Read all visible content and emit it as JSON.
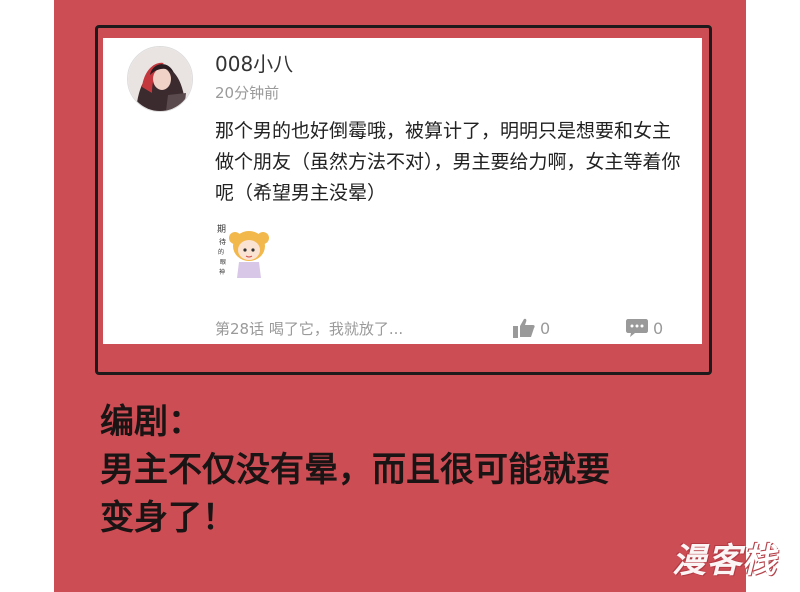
{
  "comment_card": {
    "username": "008小八",
    "time": "20分钟前",
    "text": "那个男的也好倒霉哦，被算计了，明明只是想要和女主做个朋友（虽然方法不对），男主要给力啊，女主等着你呢（希望男主没晕）",
    "chapter_link": "第28话 喝了它，我就放了...",
    "likes": "0",
    "replies": "0",
    "sticker_icon": "anime-girl-sticker",
    "avatar_icon": "user-avatar"
  },
  "caption": {
    "line1": "编剧：",
    "line2": "男主不仅没有晕，而且很可能就要",
    "line3": "变身了！"
  },
  "watermark": "漫客栈",
  "colors": {
    "panel_bg": "#cd4d55",
    "frame_border": "#1e1a1b",
    "card_bg": "#ffffff",
    "muted_text": "#9a9a9a"
  }
}
